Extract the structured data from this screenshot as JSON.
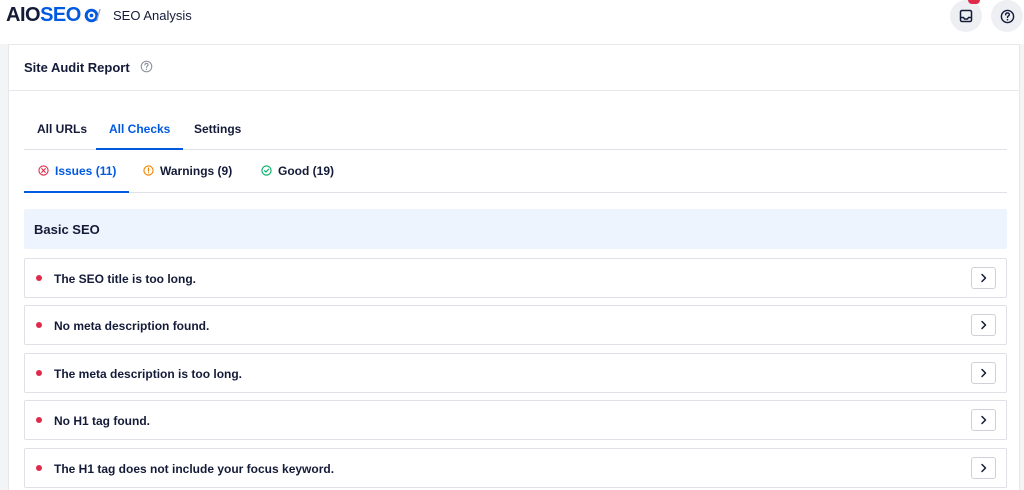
{
  "brand": {
    "part1": "AIO",
    "part2": "SEO"
  },
  "breadcrumb": {
    "separator": "/",
    "title": "SEO Analysis"
  },
  "header_icons": [
    "inbox-icon",
    "help-icon"
  ],
  "card": {
    "title": "Site Audit Report"
  },
  "tabs": [
    {
      "label": "All URLs",
      "active": false
    },
    {
      "label": "All Checks",
      "active": true
    },
    {
      "label": "Settings",
      "active": false
    }
  ],
  "subtabs": [
    {
      "label": "Issues (11)",
      "icon": "x-circle-icon",
      "color": "#df2a4a",
      "active": true
    },
    {
      "label": "Warnings (9)",
      "icon": "info-circle-icon",
      "color": "#f18200",
      "active": false
    },
    {
      "label": "Good (19)",
      "icon": "check-circle-icon",
      "color": "#00aa63",
      "active": false
    }
  ],
  "section": {
    "title": "Basic SEO"
  },
  "issues": [
    "The SEO title is too long.",
    "No meta description found.",
    "The meta description is too long.",
    "No H1 tag found.",
    "The H1 tag does not include your focus keyword."
  ],
  "colors": {
    "accent": "#005ae0",
    "issue": "#df2a4a",
    "warning": "#f18200",
    "good": "#00aa63",
    "section_bg": "#eef4fe"
  }
}
